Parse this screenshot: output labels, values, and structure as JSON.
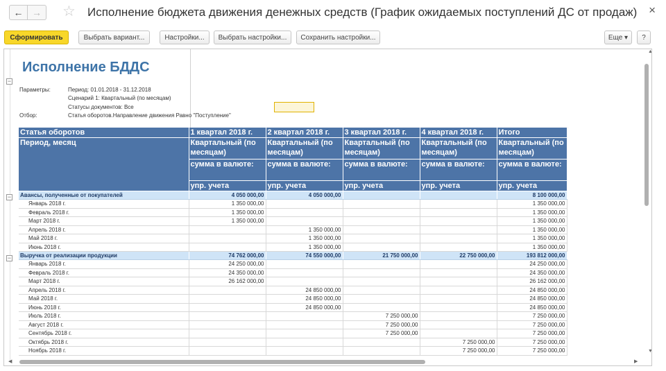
{
  "window": {
    "title": "Исполнение бюджета движения денежных средств (График ожидаемых поступлений ДС от продаж)",
    "back_icon": "←",
    "forward_icon": "→",
    "star_icon": "☆",
    "close_icon": "×"
  },
  "toolbar": {
    "form": "Сформировать",
    "choose_variant": "Выбрать вариант...",
    "settings": "Настройки...",
    "choose_settings": "Выбрать настройки...",
    "save_settings": "Сохранить настройки...",
    "more": "Еще ▾",
    "help": "?"
  },
  "report": {
    "title": "Исполнение БДДС",
    "params_label": "Параметры:",
    "param_period": "Период: 01.01.2018 - 31.12.2018",
    "param_scenario": "Сценарий 1: Квартальный (по месяцам)",
    "param_statuses": "Статусы документов: Все",
    "filter_label": "Отбор:",
    "filter_value": "Статья оборотов.Направление движения Равно \"Поступление\""
  },
  "table": {
    "header": {
      "col0_row1": "Статья оборотов",
      "col0_row2": "Период, месяц",
      "q1": "1 квартал 2018 г.",
      "q2": "2 квартал 2018 г.",
      "q3": "3 квартал 2018 г.",
      "q4": "4 квартал 2018 г.",
      "total": "Итого",
      "scenario": "Квартальный (по месяцам)",
      "sum_currency": "сумма в валюте:",
      "mgmt": "упр. учета"
    },
    "groups": [
      {
        "name": "Авансы, полученные от покупателей",
        "values": [
          "4 050 000,00",
          "4 050 000,00",
          "",
          "",
          "8 100 000,00"
        ],
        "rows": [
          {
            "label": "Январь 2018 г.",
            "values": [
              "1 350 000,00",
              "",
              "",
              "",
              "1 350 000,00"
            ]
          },
          {
            "label": "Февраль 2018 г.",
            "values": [
              "1 350 000,00",
              "",
              "",
              "",
              "1 350 000,00"
            ]
          },
          {
            "label": "Март 2018 г.",
            "values": [
              "1 350 000,00",
              "",
              "",
              "",
              "1 350 000,00"
            ]
          },
          {
            "label": "Апрель 2018 г.",
            "values": [
              "",
              "1 350 000,00",
              "",
              "",
              "1 350 000,00"
            ]
          },
          {
            "label": "Май 2018 г.",
            "values": [
              "",
              "1 350 000,00",
              "",
              "",
              "1 350 000,00"
            ]
          },
          {
            "label": "Июнь 2018 г.",
            "values": [
              "",
              "1 350 000,00",
              "",
              "",
              "1 350 000,00"
            ]
          }
        ]
      },
      {
        "name": "Выручка от реализации продукции",
        "values": [
          "74 762 000,00",
          "74 550 000,00",
          "21 750 000,00",
          "22 750 000,00",
          "193 812 000,00"
        ],
        "rows": [
          {
            "label": "Январь 2018 г.",
            "values": [
              "24 250 000,00",
              "",
              "",
              "",
              "24 250 000,00"
            ]
          },
          {
            "label": "Февраль 2018 г.",
            "values": [
              "24 350 000,00",
              "",
              "",
              "",
              "24 350 000,00"
            ]
          },
          {
            "label": "Март 2018 г.",
            "values": [
              "26 162 000,00",
              "",
              "",
              "",
              "26 162 000,00"
            ]
          },
          {
            "label": "Апрель 2018 г.",
            "values": [
              "",
              "24 850 000,00",
              "",
              "",
              "24 850 000,00"
            ]
          },
          {
            "label": "Май 2018 г.",
            "values": [
              "",
              "24 850 000,00",
              "",
              "",
              "24 850 000,00"
            ]
          },
          {
            "label": "Июнь 2018 г.",
            "values": [
              "",
              "24 850 000,00",
              "",
              "",
              "24 850 000,00"
            ]
          },
          {
            "label": "Июль 2018 г.",
            "values": [
              "",
              "",
              "7 250 000,00",
              "",
              "7 250 000,00"
            ]
          },
          {
            "label": "Август 2018 г.",
            "values": [
              "",
              "",
              "7 250 000,00",
              "",
              "7 250 000,00"
            ]
          },
          {
            "label": "Сентябрь 2018 г.",
            "values": [
              "",
              "",
              "7 250 000,00",
              "",
              "7 250 000,00"
            ]
          },
          {
            "label": "Октябрь 2018 г.",
            "values": [
              "",
              "",
              "",
              "7 250 000,00",
              "7 250 000,00"
            ]
          },
          {
            "label": "Ноябрь 2018 г.",
            "values": [
              "",
              "",
              "",
              "7 250 000,00",
              "7 250 000,00"
            ]
          }
        ]
      }
    ]
  }
}
